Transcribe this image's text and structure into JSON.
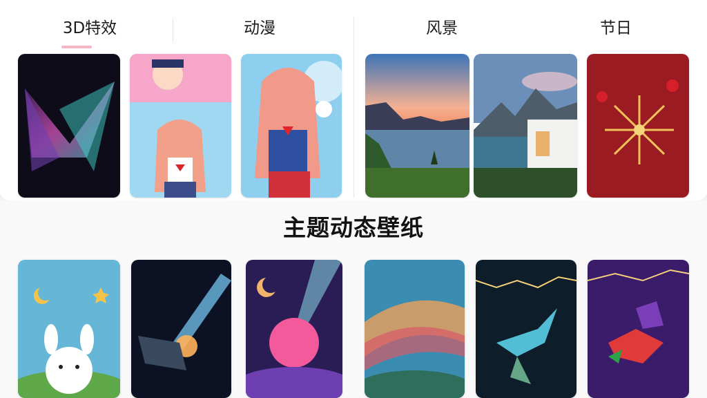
{
  "tabs": [
    {
      "label": "3D特效",
      "selected": true
    },
    {
      "label": "动漫",
      "selected": false
    },
    {
      "label": "风景",
      "selected": false
    },
    {
      "label": "节日",
      "selected": false
    }
  ],
  "section": {
    "title": "主题动态壁纸"
  },
  "colors": {
    "accent": "#f3b8c3",
    "panel": "#ffffff",
    "background": "#f3f3f4"
  }
}
